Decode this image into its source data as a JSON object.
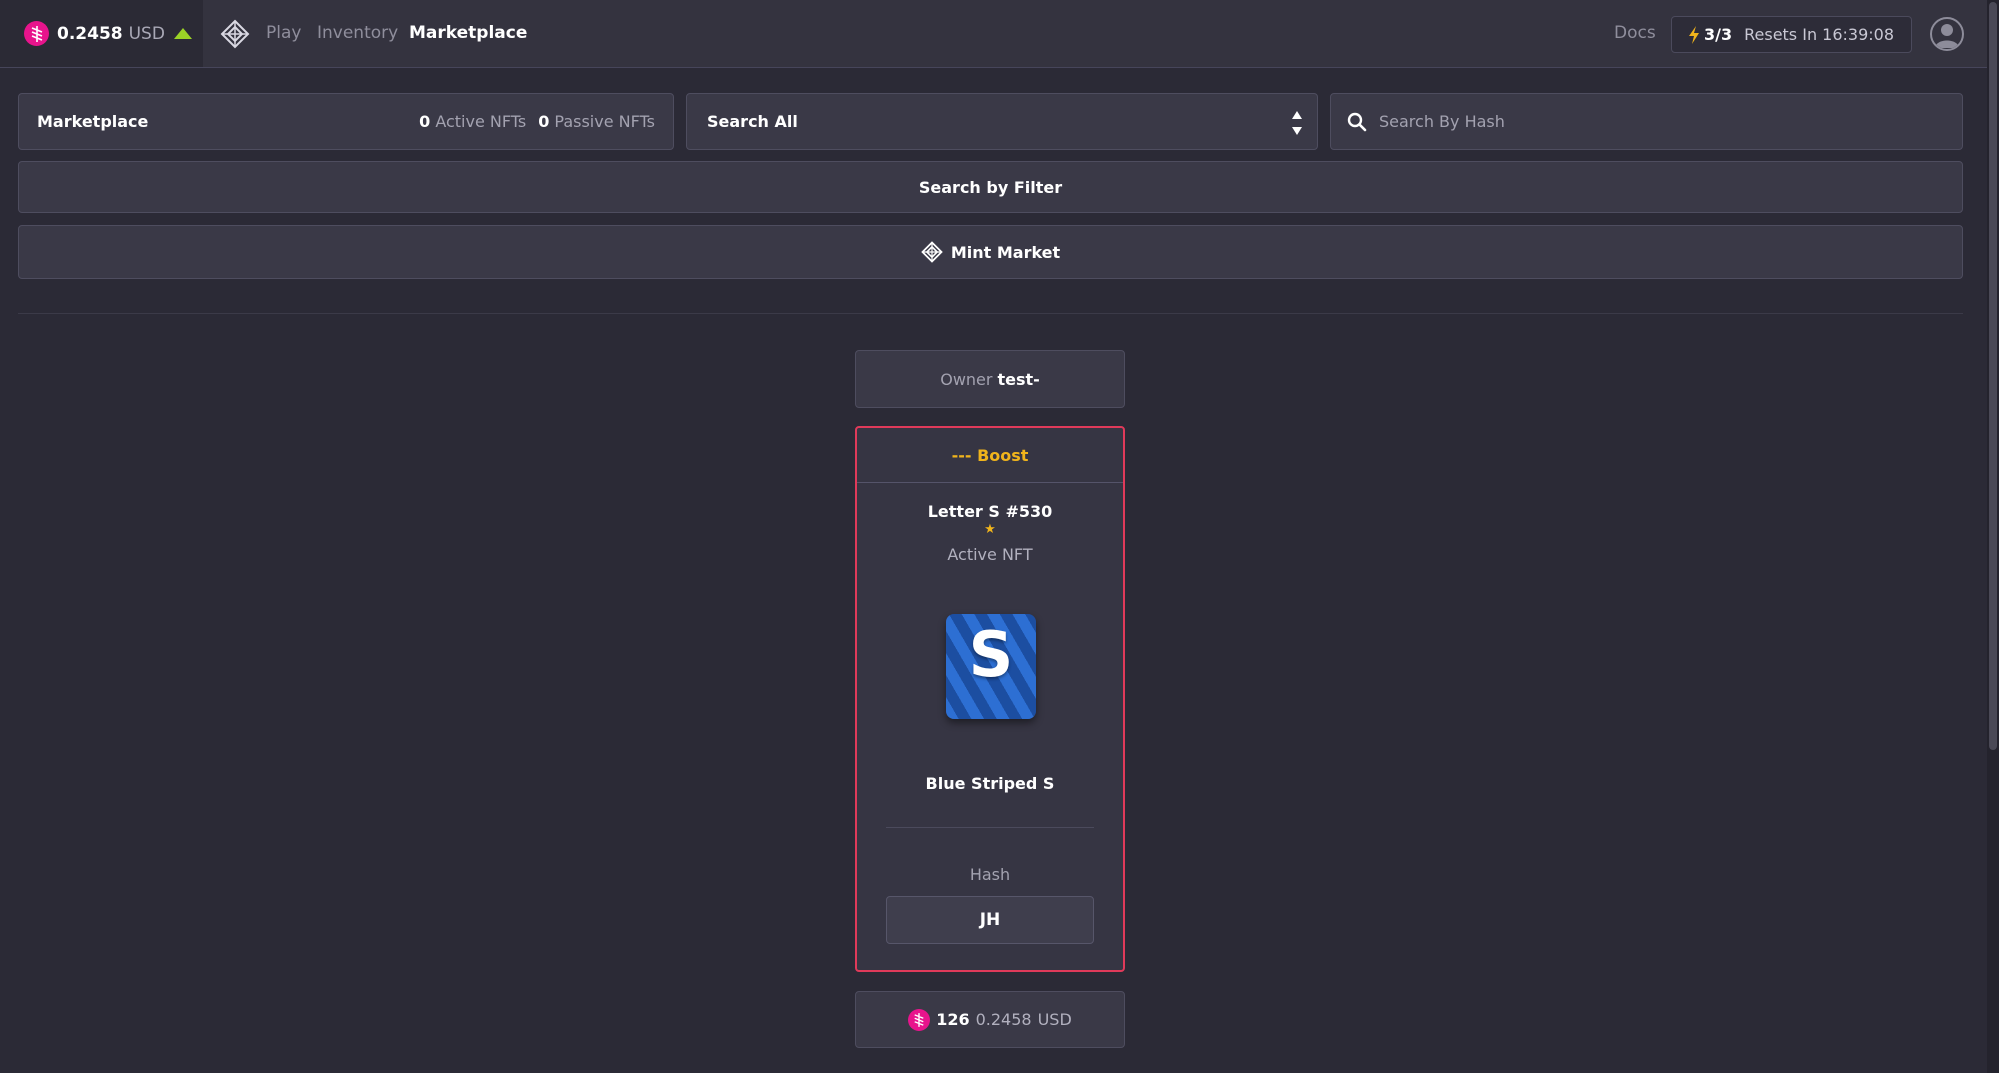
{
  "header": {
    "token_price": "0.2458",
    "token_unit": "USD",
    "nav": [
      "Play",
      "Inventory",
      "Marketplace"
    ],
    "docs_label": "Docs",
    "energy_count": "3/3",
    "resets_text": "Resets In 16:39:08"
  },
  "toolbar": {
    "market_title": "Marketplace",
    "active_count": "0",
    "active_label": "Active NFTs",
    "passive_count": "0",
    "passive_label": "Passive NFTs",
    "search_select": "Search All",
    "hash_placeholder": "Search By Hash",
    "filter_button": "Search by Filter",
    "mint_button": "Mint Market"
  },
  "listing": {
    "owner_label": "Owner",
    "owner_value": "test-",
    "boost_label": "--- Boost",
    "nft_name": "Letter S #530",
    "star": "★",
    "nft_type": "Active NFT",
    "image_letter": "S",
    "image_colors": [
      "#2d6fd3",
      "#1c4ea1"
    ],
    "nft_title": "Blue Striped S",
    "hash_label": "Hash",
    "hash_value": "JH",
    "price_amount": "126",
    "price_usd": "0.2458",
    "price_unit": "USD",
    "card_border_color": "#e03a5a",
    "boost_color": "#f0b41c"
  },
  "icons": {
    "token": "token-coin-icon",
    "trend": "arrow-up-icon",
    "logo": "diamond-logo-icon",
    "energy": "lightning-icon",
    "account": "user-avatar-icon",
    "search": "search-icon",
    "select": "sort-arrows-icon"
  }
}
